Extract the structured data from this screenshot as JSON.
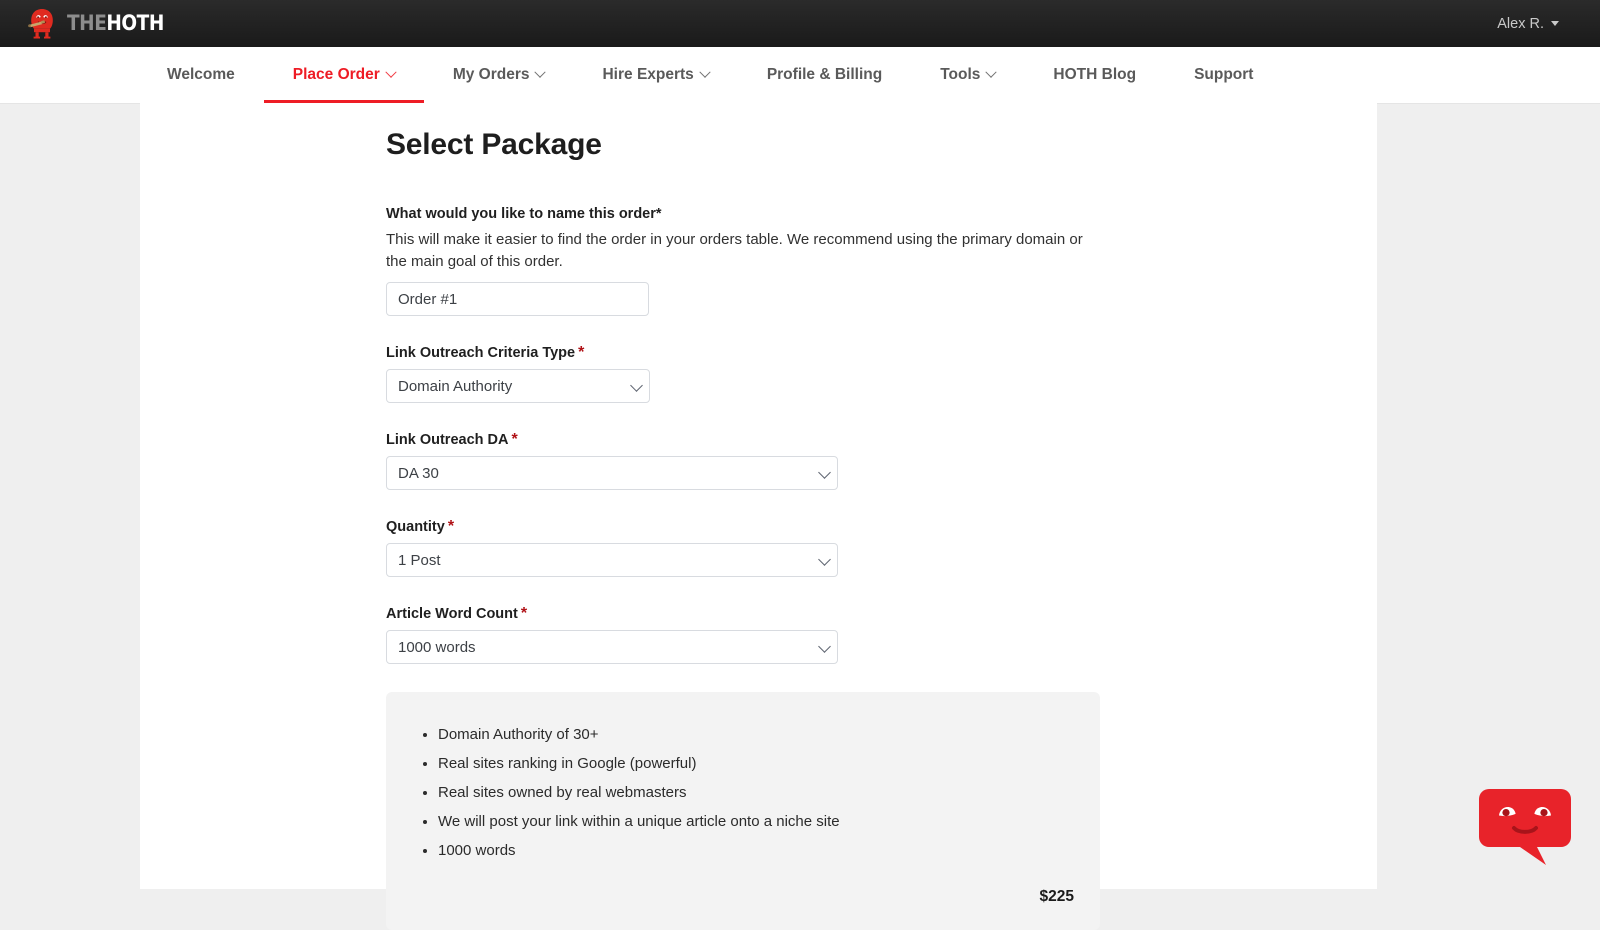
{
  "topbar": {
    "logo_icon": "hoth-mascot-icon",
    "wordmark_part1": "THE",
    "wordmark_part2": "HOTH",
    "user_name": "Alex R.",
    "user_caret_icon": "caret-down-icon",
    "background_color": "#222222"
  },
  "nav": {
    "accent_color": "#ee1c25",
    "items": [
      {
        "label": "Welcome",
        "has_chevron": false,
        "active": false
      },
      {
        "label": "Place Order",
        "has_chevron": true,
        "active": true
      },
      {
        "label": "My Orders",
        "has_chevron": true,
        "active": false
      },
      {
        "label": "Hire Experts",
        "has_chevron": true,
        "active": false
      },
      {
        "label": "Profile & Billing",
        "has_chevron": false,
        "active": false
      },
      {
        "label": "Tools",
        "has_chevron": true,
        "active": false
      },
      {
        "label": "HOTH Blog",
        "has_chevron": false,
        "active": false
      },
      {
        "label": "Support",
        "has_chevron": false,
        "active": false
      }
    ]
  },
  "page": {
    "title": "Select Package"
  },
  "form": {
    "order_name": {
      "label": "What would you like to name this order*",
      "help": "This will make it easier to find the order in your orders table. We recommend using the primary domain or the main goal of this order.",
      "value": "Order #1",
      "placeholder": "Order #1"
    },
    "criteria_type": {
      "label": "Link Outreach Criteria Type",
      "required_marker": "*",
      "value": "Domain Authority"
    },
    "outreach_da": {
      "label": "Link Outreach DA",
      "required_marker": "*",
      "value": "DA 30"
    },
    "quantity": {
      "label": "Quantity",
      "required_marker": "*",
      "value": "1 Post"
    },
    "word_count": {
      "label": "Article Word Count",
      "required_marker": "*",
      "value": "1000 words"
    }
  },
  "summary": {
    "bullets": [
      "Domain Authority of 30+",
      "Real sites ranking in Google (powerful)",
      "Real sites owned by real webmasters",
      "We will post your link within a unique article onto a niche site",
      "1000 words"
    ],
    "price": "$225"
  },
  "chat": {
    "icon": "chat-bubble-mascot-icon",
    "color": "#e8232a"
  }
}
